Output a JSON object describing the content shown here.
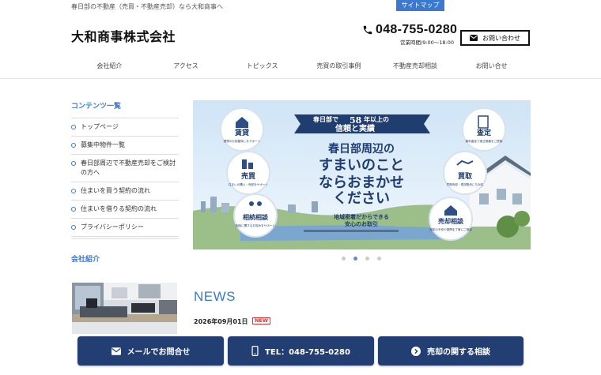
{
  "header": {
    "tagline": "春日部の不動産（売買・不動産売却）なら大和商事へ",
    "sitemap_label": "サイトマップ",
    "logo": "大和商事株式会社",
    "phone": "048-755-0280",
    "hours": "営業時間/9:00〜18:00",
    "contact_label": "お問い合わせ"
  },
  "nav": {
    "items": [
      {
        "label": "会社紹介"
      },
      {
        "label": "アクセス"
      },
      {
        "label": "トピックス"
      },
      {
        "label": "売買の取引事例"
      },
      {
        "label": "不動産売却相談"
      },
      {
        "label": "お問い合せ"
      }
    ]
  },
  "sidebar": {
    "contents_heading": "コンテンツ一覧",
    "items": [
      {
        "label": "トップページ"
      },
      {
        "label": "募集中物件一覧"
      },
      {
        "label": "春日部周辺で不動産売却をご検討の方へ"
      },
      {
        "label": "住まいを買う契約の流れ"
      },
      {
        "label": "住まいを借りる契約の流れ"
      },
      {
        "label": "プライバシーポリシー"
      }
    ],
    "company_heading": "会社紹介"
  },
  "hero": {
    "ribbon_small": "春日部で",
    "ribbon_years": "58",
    "ribbon_unit": "年以上の",
    "ribbon_main": "信頼と実績",
    "headline_1": "春日部周辺の",
    "headline_2": "すまいのこと",
    "headline_3": "ならおまかせ",
    "headline_4": "ください",
    "sub_1": "地域密着だからできる",
    "sub_2": "安心のお取引",
    "circles": [
      {
        "title": "賃貸",
        "desc": "理想のお部屋探しをサポート"
      },
      {
        "title": "査定",
        "desc": "無料査定で適正価格をご提案"
      },
      {
        "title": "売買",
        "desc": "住まいの購入・売却をサポート"
      },
      {
        "title": "買取",
        "desc": "早期売却・現況販売にも対応"
      },
      {
        "title": "相続相談",
        "desc": "相続に関するお悩みをサポート"
      },
      {
        "title": "売却相談",
        "desc": "売却の不安や疑問を丁寧にご相談"
      }
    ],
    "slide_count": 4,
    "active_slide": 2
  },
  "news": {
    "title": "NEWS",
    "date": "2026年09月01日",
    "badge": "NEW"
  },
  "cta": {
    "mail_label": "メールでお問合せ",
    "phone_label": "TEL：048-755-0280",
    "sell_label": "売却の関する相談"
  },
  "colors": {
    "accent": "#3b78d0",
    "cta_bg": "#233e72",
    "badge": "#dd3333"
  }
}
